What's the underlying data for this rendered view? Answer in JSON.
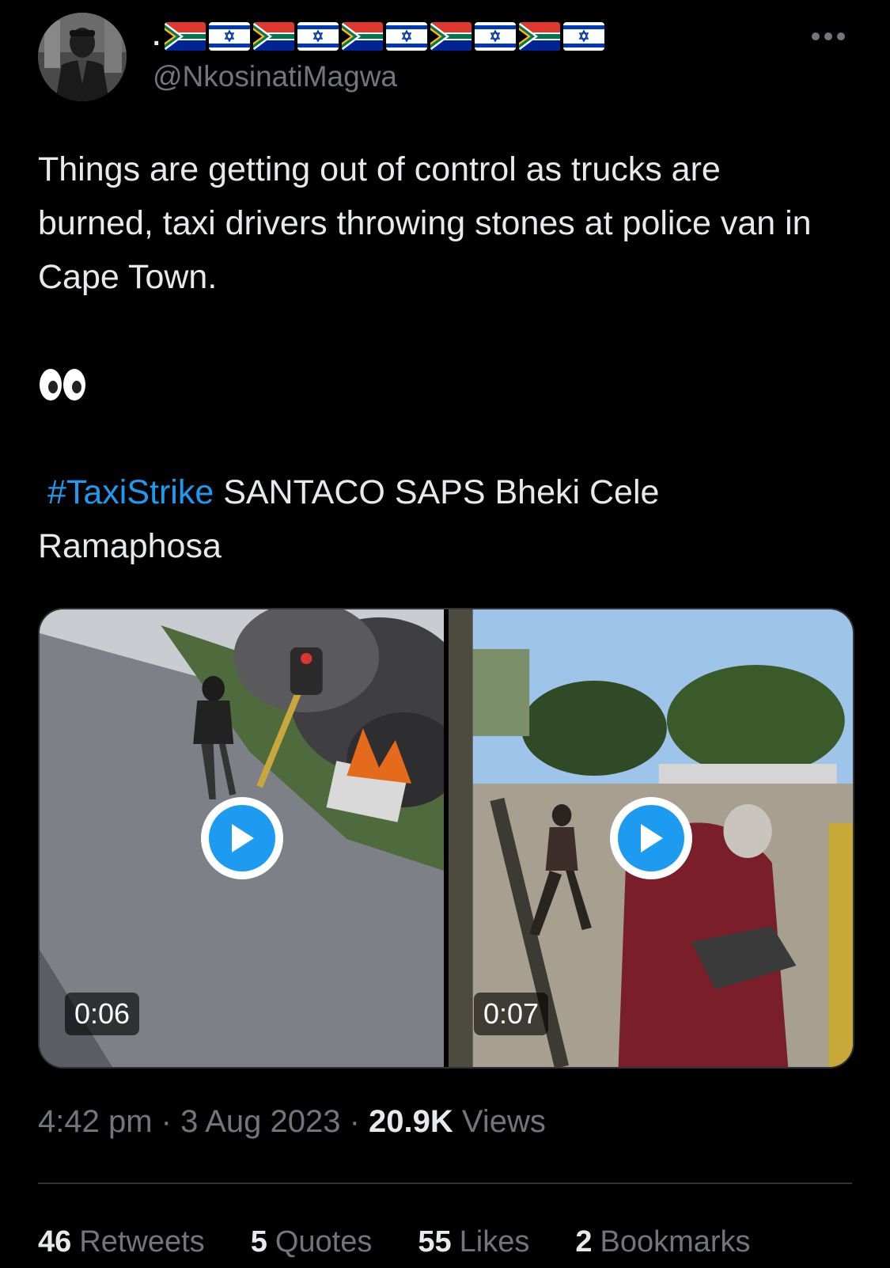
{
  "author": {
    "name_prefix": ".",
    "name_flags": [
      "flag-south-africa",
      "flag-israel",
      "flag-south-africa",
      "flag-israel",
      "flag-south-africa",
      "flag-israel",
      "flag-south-africa",
      "flag-israel",
      "flag-south-africa",
      "flag-israel"
    ],
    "handle": "@NkosinatiMagwa"
  },
  "more_icon": "more-horizontal-icon",
  "tweet": {
    "text": "Things are getting out of control as trucks are burned, taxi drivers throwing stones at police van in Cape Town.",
    "emoji": "eyes-emoji",
    "hashtag": "#TaxiStrike",
    "tags_rest": " SANTACO SAPS Bheki Cele Ramaphosa"
  },
  "media": [
    {
      "type": "video",
      "duration": "0:06",
      "icon": "play-icon"
    },
    {
      "type": "video",
      "duration": "0:07",
      "icon": "play-icon"
    }
  ],
  "meta": {
    "time": "4:42 pm",
    "separator": " · ",
    "date": "3 Aug 2023",
    "views_count": "20.9K",
    "views_label": " Views"
  },
  "stats": {
    "retweets_count": "46",
    "retweets_label": "Retweets",
    "quotes_count": "5",
    "quotes_label": "Quotes",
    "likes_count": "55",
    "likes_label": "Likes",
    "bookmarks_count": "2",
    "bookmarks_label": "Bookmarks"
  },
  "colors": {
    "background": "#000000",
    "text": "#e7e9ea",
    "secondary_text": "#71767b",
    "accent": "#1d9bf0",
    "divider": "#2f3336"
  }
}
